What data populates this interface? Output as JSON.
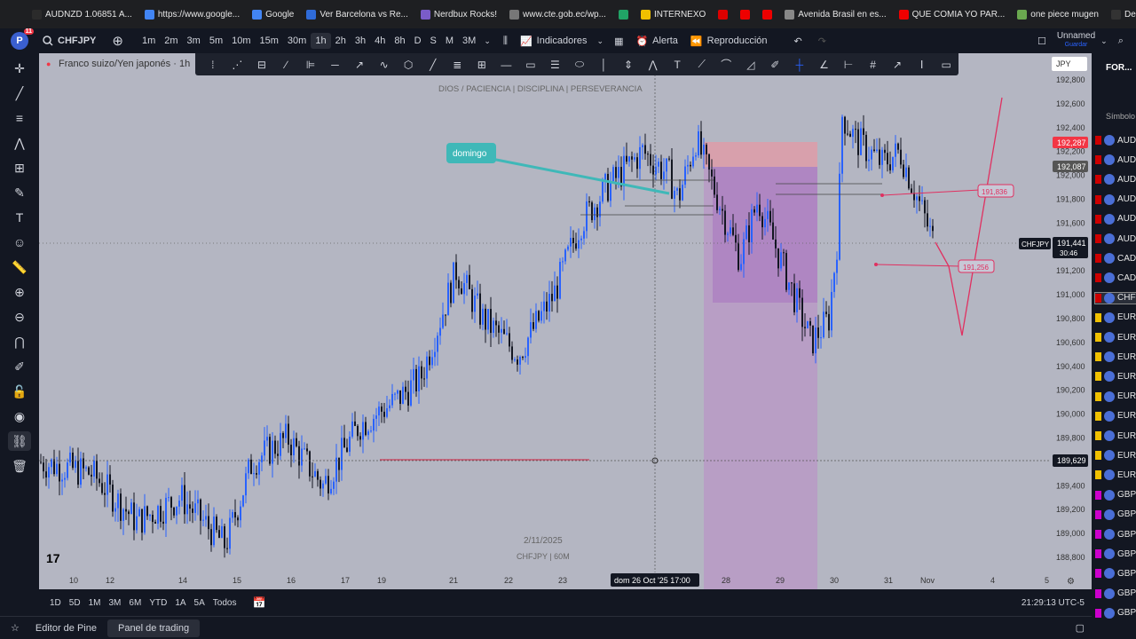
{
  "bookmarks": [
    {
      "label": "AUDNZD 1.06851 A...",
      "color": "#2b2b2b"
    },
    {
      "label": "https://www.google...",
      "color": "#4285f4"
    },
    {
      "label": "Google",
      "color": "#4285f4"
    },
    {
      "label": "Ver Barcelona vs Re...",
      "color": "#2f6bd8"
    },
    {
      "label": "Nerdbux Rocks!",
      "color": "#7a5cc8"
    },
    {
      "label": "www.cte.gob.ec/wp...",
      "color": "#777"
    },
    {
      "label": "",
      "color": "#21a366"
    },
    {
      "label": "INTERNEXO",
      "color": "#f0c000"
    },
    {
      "label": "",
      "color": "#d00"
    },
    {
      "label": "",
      "color": "#e00"
    },
    {
      "label": "",
      "color": "#e00"
    },
    {
      "label": "Avenida Brasil en es...",
      "color": "#888"
    },
    {
      "label": "QUE COMIA YO PAR...",
      "color": "#e00"
    },
    {
      "label": "one piece mugen",
      "color": "#6aa84f"
    },
    {
      "label": "Descargar Musica de...",
      "color": "#333"
    }
  ],
  "topbar": {
    "badge": "11",
    "symbol": "CHFJPY",
    "timeframes": [
      "1m",
      "2m",
      "3m",
      "5m",
      "10m",
      "15m",
      "30m",
      "1h",
      "2h",
      "3h",
      "4h",
      "8h",
      "D",
      "S",
      "M",
      "3M"
    ],
    "active_tf": "1h",
    "indicators": "Indicadores",
    "alert": "Alerta",
    "replay": "Reproducción",
    "layout_name": "Unnamed",
    "layout_sub": "Guardar"
  },
  "chart": {
    "title": "Franco suizo/Yen japonés · 1h",
    "watermark_top": "DIOS / PACIENCIA  |  DISCIPLINA  |  PERSEVERANCIA",
    "watermark_date": "2/11/2025",
    "watermark_sym": "CHFJPY | 60M",
    "callout": "domingo",
    "currency": "JPY",
    "price_labels": [
      "192,800",
      "192,600",
      "192,400",
      "192,200",
      "192,000",
      "191,800",
      "191,600",
      "191,400",
      "191,200",
      "191,000",
      "190,800",
      "190,600",
      "190,400",
      "190,200",
      "190,000",
      "189,800",
      "189,600",
      "189,400",
      "189,200",
      "189,000",
      "188,800"
    ],
    "time_labels": [
      "10",
      "12",
      "14",
      "15",
      "16",
      "17",
      "19",
      "21",
      "22",
      "23",
      "28",
      "29",
      "30",
      "31",
      "Nov",
      "4",
      "5"
    ],
    "cursor_time": "dom 26 Oct '25   17:00",
    "tag_red": "192,287",
    "tag_grey": "192,087",
    "tag_sym": "CHFJPY",
    "tag_price": "191,441",
    "tag_countdown": "30:46",
    "tag_cursor": "189,629",
    "label_a": "191,836",
    "label_b": "191,256"
  },
  "bottom": {
    "ranges": [
      "1D",
      "5D",
      "1M",
      "3M",
      "6M",
      "YTD",
      "1A",
      "5A",
      "Todos"
    ],
    "clock": "21:29:13 UTC-5",
    "tabs": [
      "Editor de Pine",
      "Panel de trading"
    ]
  },
  "watchlist": {
    "header": "FOR...",
    "subheader": "Símbolo",
    "items": [
      "AUD",
      "AUD",
      "AUD",
      "AUD",
      "AUD",
      "AUD",
      "CAD",
      "CAD",
      "CHF",
      "EUR",
      "EUR",
      "EUR",
      "EUR",
      "EUR",
      "EUR",
      "EUR",
      "EUR",
      "EUR",
      "GBP",
      "GBP",
      "GBP",
      "GBP",
      "GBP",
      "GBP",
      "GBP"
    ]
  }
}
